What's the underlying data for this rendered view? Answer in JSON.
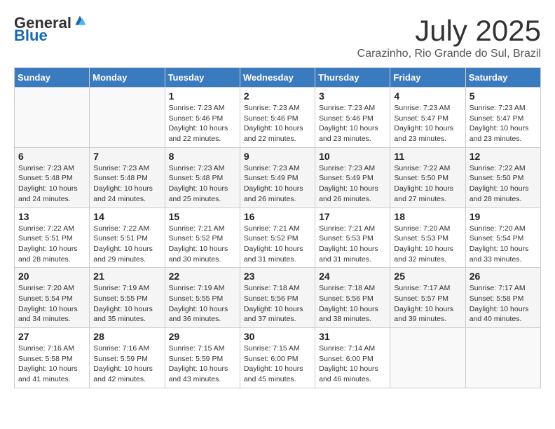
{
  "header": {
    "logo_general": "General",
    "logo_blue": "Blue",
    "month_title": "July 2025",
    "location": "Carazinho, Rio Grande do Sul, Brazil"
  },
  "days_of_week": [
    "Sunday",
    "Monday",
    "Tuesday",
    "Wednesday",
    "Thursday",
    "Friday",
    "Saturday"
  ],
  "weeks": [
    [
      {
        "day": "",
        "empty": true
      },
      {
        "day": "",
        "empty": true
      },
      {
        "day": "1",
        "sunrise": "Sunrise: 7:23 AM",
        "sunset": "Sunset: 5:46 PM",
        "daylight": "Daylight: 10 hours and 22 minutes."
      },
      {
        "day": "2",
        "sunrise": "Sunrise: 7:23 AM",
        "sunset": "Sunset: 5:46 PM",
        "daylight": "Daylight: 10 hours and 22 minutes."
      },
      {
        "day": "3",
        "sunrise": "Sunrise: 7:23 AM",
        "sunset": "Sunset: 5:46 PM",
        "daylight": "Daylight: 10 hours and 23 minutes."
      },
      {
        "day": "4",
        "sunrise": "Sunrise: 7:23 AM",
        "sunset": "Sunset: 5:47 PM",
        "daylight": "Daylight: 10 hours and 23 minutes."
      },
      {
        "day": "5",
        "sunrise": "Sunrise: 7:23 AM",
        "sunset": "Sunset: 5:47 PM",
        "daylight": "Daylight: 10 hours and 23 minutes."
      }
    ],
    [
      {
        "day": "6",
        "sunrise": "Sunrise: 7:23 AM",
        "sunset": "Sunset: 5:48 PM",
        "daylight": "Daylight: 10 hours and 24 minutes."
      },
      {
        "day": "7",
        "sunrise": "Sunrise: 7:23 AM",
        "sunset": "Sunset: 5:48 PM",
        "daylight": "Daylight: 10 hours and 24 minutes."
      },
      {
        "day": "8",
        "sunrise": "Sunrise: 7:23 AM",
        "sunset": "Sunset: 5:48 PM",
        "daylight": "Daylight: 10 hours and 25 minutes."
      },
      {
        "day": "9",
        "sunrise": "Sunrise: 7:23 AM",
        "sunset": "Sunset: 5:49 PM",
        "daylight": "Daylight: 10 hours and 26 minutes."
      },
      {
        "day": "10",
        "sunrise": "Sunrise: 7:23 AM",
        "sunset": "Sunset: 5:49 PM",
        "daylight": "Daylight: 10 hours and 26 minutes."
      },
      {
        "day": "11",
        "sunrise": "Sunrise: 7:22 AM",
        "sunset": "Sunset: 5:50 PM",
        "daylight": "Daylight: 10 hours and 27 minutes."
      },
      {
        "day": "12",
        "sunrise": "Sunrise: 7:22 AM",
        "sunset": "Sunset: 5:50 PM",
        "daylight": "Daylight: 10 hours and 28 minutes."
      }
    ],
    [
      {
        "day": "13",
        "sunrise": "Sunrise: 7:22 AM",
        "sunset": "Sunset: 5:51 PM",
        "daylight": "Daylight: 10 hours and 28 minutes."
      },
      {
        "day": "14",
        "sunrise": "Sunrise: 7:22 AM",
        "sunset": "Sunset: 5:51 PM",
        "daylight": "Daylight: 10 hours and 29 minutes."
      },
      {
        "day": "15",
        "sunrise": "Sunrise: 7:21 AM",
        "sunset": "Sunset: 5:52 PM",
        "daylight": "Daylight: 10 hours and 30 minutes."
      },
      {
        "day": "16",
        "sunrise": "Sunrise: 7:21 AM",
        "sunset": "Sunset: 5:52 PM",
        "daylight": "Daylight: 10 hours and 31 minutes."
      },
      {
        "day": "17",
        "sunrise": "Sunrise: 7:21 AM",
        "sunset": "Sunset: 5:53 PM",
        "daylight": "Daylight: 10 hours and 31 minutes."
      },
      {
        "day": "18",
        "sunrise": "Sunrise: 7:20 AM",
        "sunset": "Sunset: 5:53 PM",
        "daylight": "Daylight: 10 hours and 32 minutes."
      },
      {
        "day": "19",
        "sunrise": "Sunrise: 7:20 AM",
        "sunset": "Sunset: 5:54 PM",
        "daylight": "Daylight: 10 hours and 33 minutes."
      }
    ],
    [
      {
        "day": "20",
        "sunrise": "Sunrise: 7:20 AM",
        "sunset": "Sunset: 5:54 PM",
        "daylight": "Daylight: 10 hours and 34 minutes."
      },
      {
        "day": "21",
        "sunrise": "Sunrise: 7:19 AM",
        "sunset": "Sunset: 5:55 PM",
        "daylight": "Daylight: 10 hours and 35 minutes."
      },
      {
        "day": "22",
        "sunrise": "Sunrise: 7:19 AM",
        "sunset": "Sunset: 5:55 PM",
        "daylight": "Daylight: 10 hours and 36 minutes."
      },
      {
        "day": "23",
        "sunrise": "Sunrise: 7:18 AM",
        "sunset": "Sunset: 5:56 PM",
        "daylight": "Daylight: 10 hours and 37 minutes."
      },
      {
        "day": "24",
        "sunrise": "Sunrise: 7:18 AM",
        "sunset": "Sunset: 5:56 PM",
        "daylight": "Daylight: 10 hours and 38 minutes."
      },
      {
        "day": "25",
        "sunrise": "Sunrise: 7:17 AM",
        "sunset": "Sunset: 5:57 PM",
        "daylight": "Daylight: 10 hours and 39 minutes."
      },
      {
        "day": "26",
        "sunrise": "Sunrise: 7:17 AM",
        "sunset": "Sunset: 5:58 PM",
        "daylight": "Daylight: 10 hours and 40 minutes."
      }
    ],
    [
      {
        "day": "27",
        "sunrise": "Sunrise: 7:16 AM",
        "sunset": "Sunset: 5:58 PM",
        "daylight": "Daylight: 10 hours and 41 minutes."
      },
      {
        "day": "28",
        "sunrise": "Sunrise: 7:16 AM",
        "sunset": "Sunset: 5:59 PM",
        "daylight": "Daylight: 10 hours and 42 minutes."
      },
      {
        "day": "29",
        "sunrise": "Sunrise: 7:15 AM",
        "sunset": "Sunset: 5:59 PM",
        "daylight": "Daylight: 10 hours and 43 minutes."
      },
      {
        "day": "30",
        "sunrise": "Sunrise: 7:15 AM",
        "sunset": "Sunset: 6:00 PM",
        "daylight": "Daylight: 10 hours and 45 minutes."
      },
      {
        "day": "31",
        "sunrise": "Sunrise: 7:14 AM",
        "sunset": "Sunset: 6:00 PM",
        "daylight": "Daylight: 10 hours and 46 minutes."
      },
      {
        "day": "",
        "empty": true
      },
      {
        "day": "",
        "empty": true
      }
    ]
  ]
}
